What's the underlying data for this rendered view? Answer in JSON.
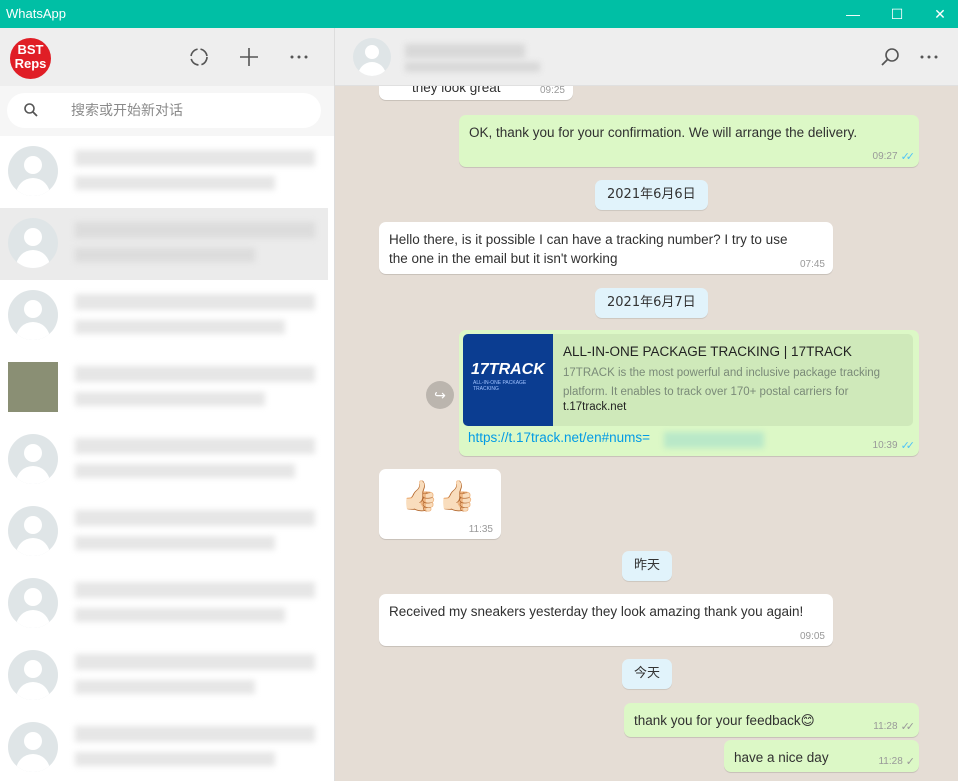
{
  "window": {
    "title": "WhatsApp",
    "controls": {
      "minimize": "—",
      "maximize": "☐",
      "close": "✕"
    }
  },
  "sidebar": {
    "logo": {
      "line1": "BST",
      "line2": "Reps"
    },
    "header_icons": [
      "status-icon",
      "new-chat-icon",
      "menu-icon"
    ],
    "search": {
      "placeholder": "搜索或开始新对话"
    },
    "chats_count_visible": 9
  },
  "conversation": {
    "messages": [
      {
        "type": "in",
        "text": "they look great",
        "time": "09:25"
      },
      {
        "type": "out",
        "text": "OK, thank you for your confirmation. We will arrange the delivery.",
        "time": "09:27",
        "status": "read"
      },
      {
        "type": "date",
        "text": "2021年6月6日"
      },
      {
        "type": "in",
        "text_line1": "Hello there, is it possible I can have a  tracking number? I try to use",
        "text_line2": "the one in the email but it isn't working",
        "time": "07:45"
      },
      {
        "type": "date",
        "text": "2021年6月7日"
      },
      {
        "type": "out-link",
        "preview_title": "ALL-IN-ONE PACKAGE TRACKING | 17TRACK",
        "preview_desc": "17TRACK is the most powerful and inclusive package tracking platform. It enables to track over 170+ postal carriers for",
        "preview_host": "t.17track.net",
        "thumb_logo": "17TRACK",
        "thumb_sub": "ALL-IN-ONE PACKAGE TRACKING",
        "link": "https://t.17track.net/en#nums=",
        "time": "10:39",
        "status": "read"
      },
      {
        "type": "in-emoji",
        "text": "👍🏻👍🏻",
        "time": "11:35"
      },
      {
        "type": "date",
        "text": "昨天"
      },
      {
        "type": "in",
        "text": "Received my sneakers yesterday they look amazing thank you again!",
        "time": "09:05"
      },
      {
        "type": "date",
        "text": "今天"
      },
      {
        "type": "out",
        "text": "thank you for your feedback😊",
        "time": "11:28",
        "status": "delivered"
      },
      {
        "type": "out",
        "text": "have a nice day",
        "time": "11:28",
        "status": "sent"
      }
    ]
  },
  "colors": {
    "titlebar": "#00bfa5",
    "incoming_bubble": "#ffffff",
    "outgoing_bubble": "#dcf8c6",
    "chat_background": "#e5ddd5",
    "date_chip": "#e1f3fb",
    "read_tick": "#4fc3f7"
  }
}
